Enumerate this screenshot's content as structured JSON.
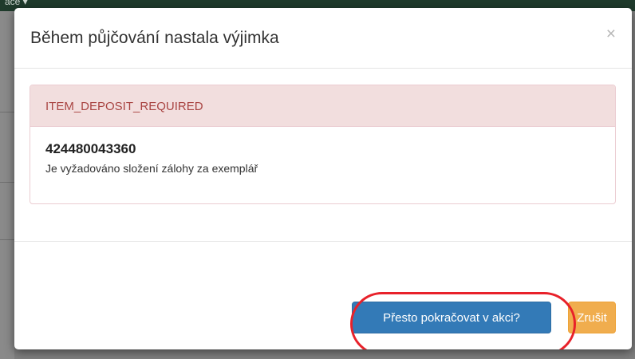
{
  "backdrop": {
    "nav_text": "ace ▾"
  },
  "modal": {
    "title": "Během půjčování nastala výjimka",
    "close_label": "×",
    "alert": {
      "code": "ITEM_DEPOSIT_REQUIRED",
      "item_id": "424480043360",
      "message": "Je vyžadováno složení zálohy za exemplář"
    },
    "buttons": {
      "continue_label": "Přesto pokračovat v akci?",
      "cancel_label": "Zrušit"
    }
  },
  "colors": {
    "primary": "#337ab7",
    "warning": "#f0ad4e",
    "danger_text": "#a94442",
    "danger_bg": "#f2dede",
    "annotation_ring": "#e8212a"
  }
}
